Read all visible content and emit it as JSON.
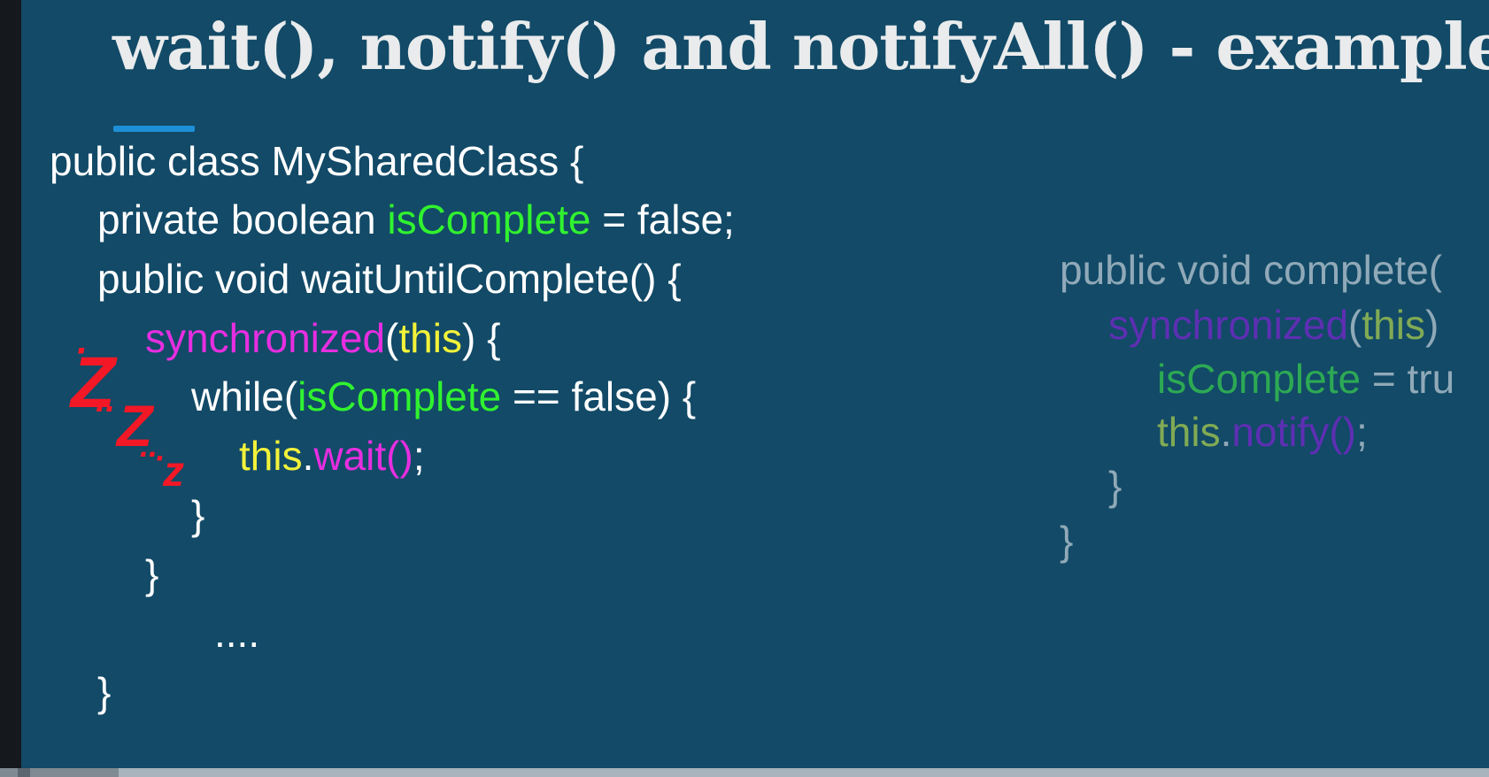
{
  "slide": {
    "title": "wait(), notify() and notifyAll() - example",
    "colors": {
      "background": "#124a67",
      "accent_underline": "#1d8fd6",
      "variable_green": "#31f22f",
      "method_magenta": "#e62ee0",
      "this_yellow": "#f2f23a",
      "sleep_red": "#f21826"
    }
  },
  "left_code": {
    "l1": "public class MySharedClass {",
    "l2_a": "private boolean ",
    "l2_b": "isComplete",
    "l2_c": " = false;",
    "l3": "public void waitUntilComplete() {",
    "l4_a": "synchronized",
    "l4_b": "(",
    "l4_c": "this",
    "l4_d": ") {",
    "l5_a": "while(",
    "l5_b": "isComplete",
    "l5_c": " == false) {",
    "l6_a": "this",
    "l6_b": ".",
    "l6_c": "wait()",
    "l6_d": ";",
    "l7": "}",
    "l8": "}",
    "l9": "....",
    "l10": "}"
  },
  "right_code": {
    "r1": "public void complete(",
    "r2_a": "synchronized",
    "r2_b": "(",
    "r2_c": "this",
    "r2_d": ")",
    "r3_a": "isComplete",
    "r3_b": " = tru",
    "r4_a": "this",
    "r4_b": ".",
    "r4_c": "notify()",
    "r4_d": ";",
    "r5": "}",
    "r6": "}"
  },
  "sleep_marks": {
    "z1": "Z",
    "z2": "Z",
    "z3": "z",
    "dots1": "·",
    "dots2": "..",
    "dots3": "..",
    "dots4": "·"
  }
}
